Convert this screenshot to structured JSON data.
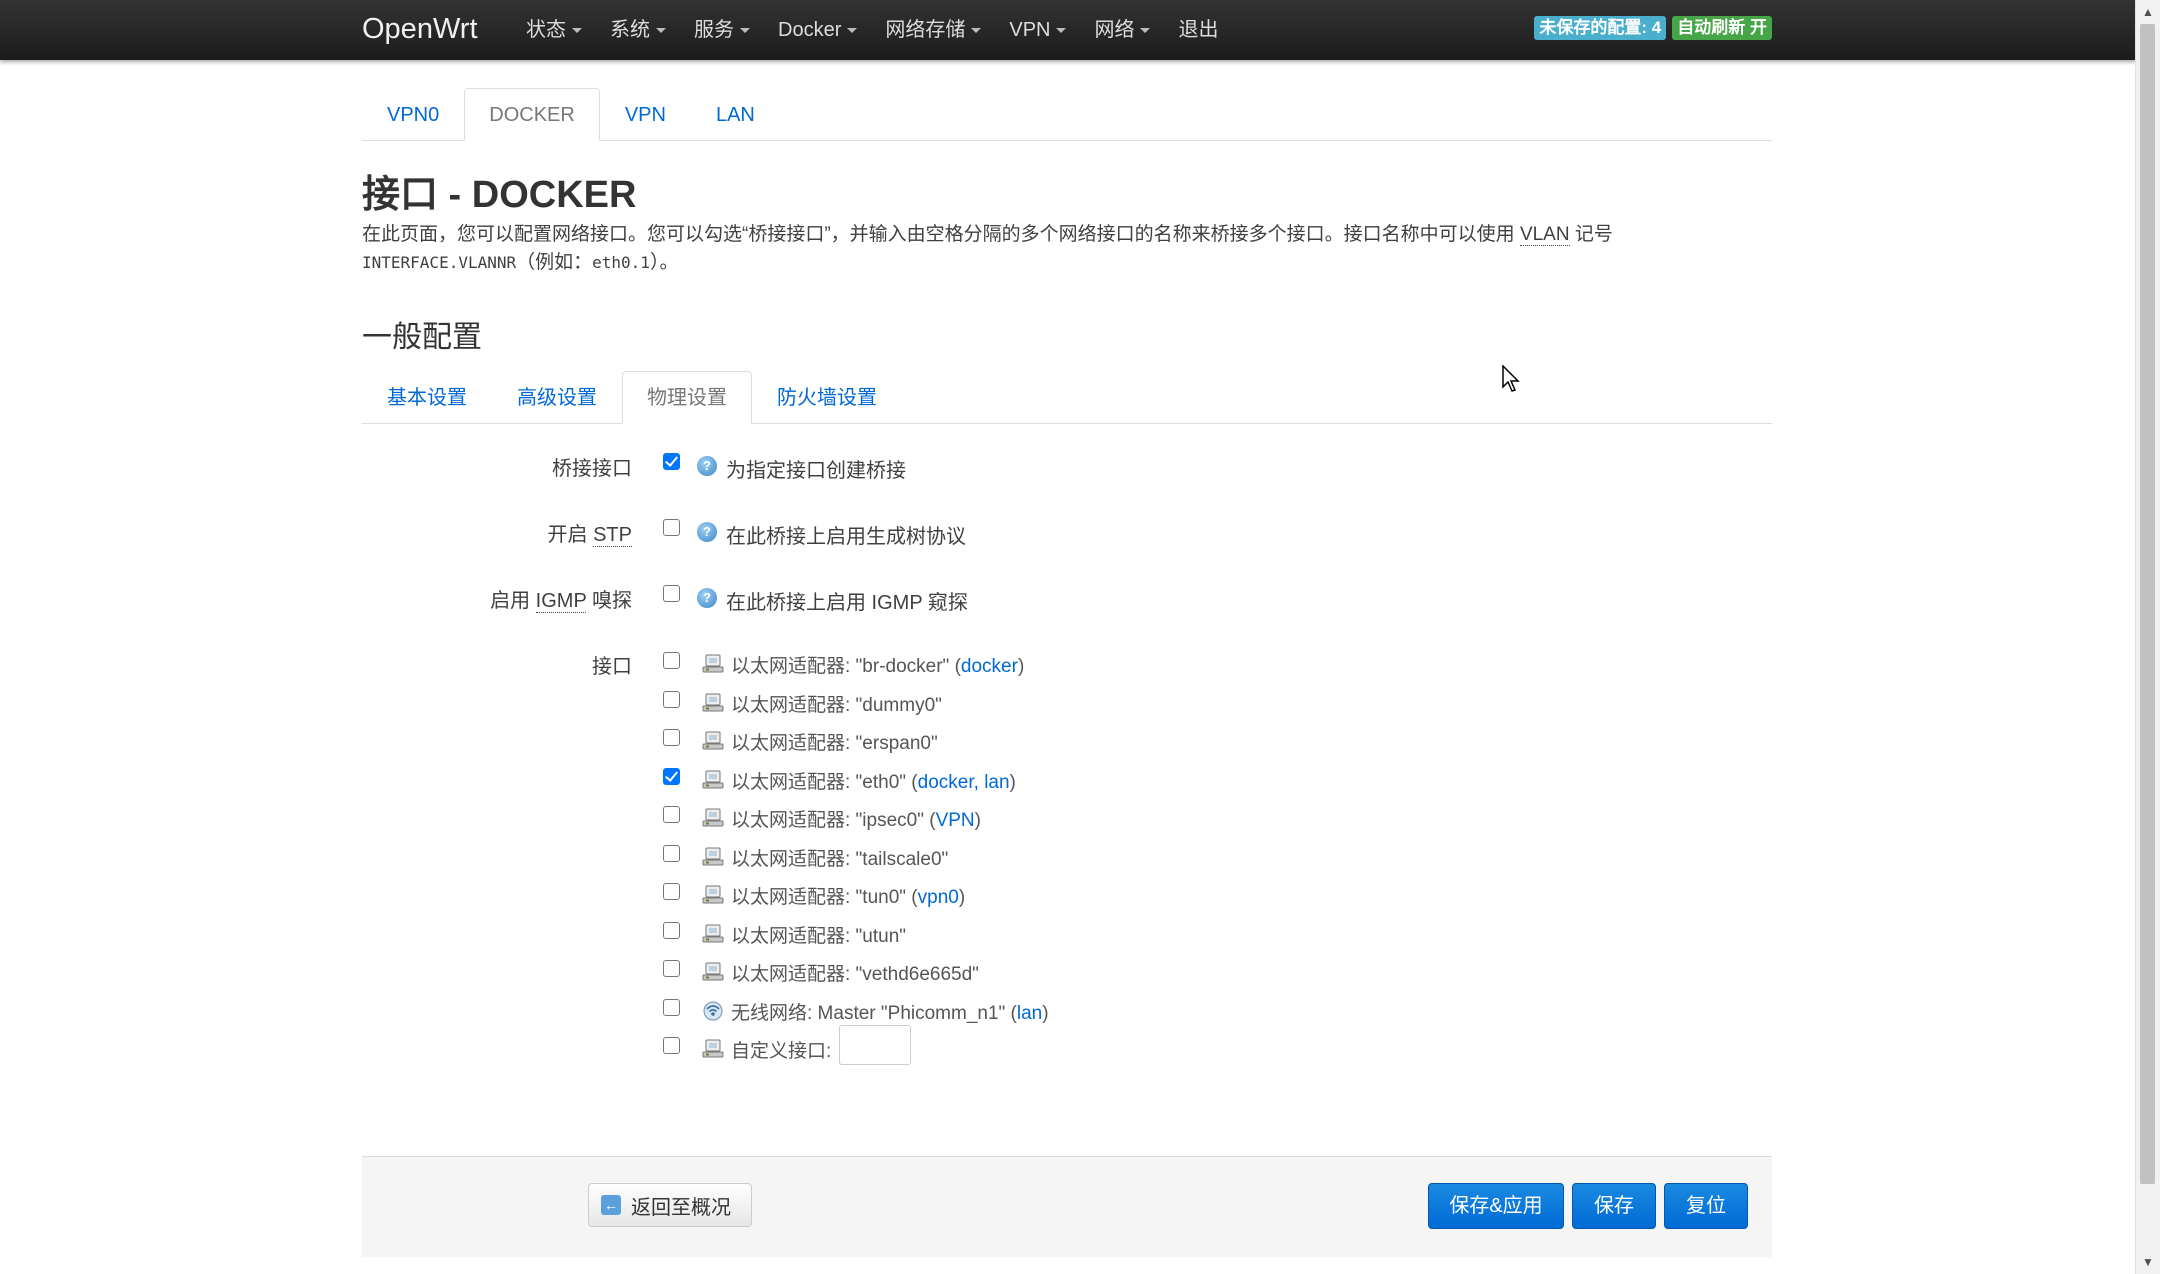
{
  "navbar": {
    "brand": "OpenWrt",
    "menu": [
      {
        "label": "状态",
        "dropdown": true
      },
      {
        "label": "系统",
        "dropdown": true
      },
      {
        "label": "服务",
        "dropdown": true
      },
      {
        "label": "Docker",
        "dropdown": true
      },
      {
        "label": "网络存储",
        "dropdown": true
      },
      {
        "label": "VPN",
        "dropdown": true
      },
      {
        "label": "网络",
        "dropdown": true
      },
      {
        "label": "退出",
        "dropdown": false
      }
    ],
    "badges": {
      "unsaved": "未保存的配置: 4",
      "autorefresh": "自动刷新 开"
    }
  },
  "iface_tabs": [
    {
      "label": "VPN0",
      "active": false
    },
    {
      "label": "DOCKER",
      "active": true
    },
    {
      "label": "VPN",
      "active": false
    },
    {
      "label": "LAN",
      "active": false
    }
  ],
  "page": {
    "title": "接口 - DOCKER",
    "desc_part1": "在此页面，您可以配置网络接口。您可以勾选“桥接接口”，并输入由空格分隔的多个网络接口的名称来桥接多个接口。接口名称中可以使用 ",
    "desc_abbr": "VLAN",
    "desc_part2": " 记号",
    "desc_mono1": "INTERFACE.VLANNR",
    "desc_part3": "（例如：",
    "desc_mono2": "eth0.1",
    "desc_part4": "）。"
  },
  "section": {
    "title": "一般配置",
    "subtabs": [
      {
        "label": "基本设置",
        "active": false
      },
      {
        "label": "高级设置",
        "active": false
      },
      {
        "label": "物理设置",
        "active": true
      },
      {
        "label": "防火墙设置",
        "active": false
      }
    ]
  },
  "options": {
    "bridge": {
      "label": "桥接接口",
      "help": "为指定接口创建桥接",
      "checked": true
    },
    "stp": {
      "label_prefix": "开启 ",
      "label_abbr": "STP",
      "help": "在此桥接上启用生成树协议",
      "checked": false
    },
    "igmp": {
      "label_prefix": "启用 ",
      "label_abbr": "IGMP",
      "label_suffix": " 嗅探",
      "help": "在此桥接上启用 IGMP 窥探",
      "checked": false
    }
  },
  "interfaces": {
    "label": "接口",
    "items": [
      {
        "text": "以太网适配器: \"br-docker\" (",
        "links": "docker",
        "tail": ")",
        "checked": false,
        "type": "ethernet"
      },
      {
        "text": "以太网适配器: \"dummy0\"",
        "links": "",
        "tail": "",
        "checked": false,
        "type": "ethernet"
      },
      {
        "text": "以太网适配器: \"erspan0\"",
        "links": "",
        "tail": "",
        "checked": false,
        "type": "ethernet"
      },
      {
        "text": "以太网适配器: \"eth0\" (",
        "links": "docker, lan",
        "tail": ")",
        "checked": true,
        "type": "ethernet"
      },
      {
        "text": "以太网适配器: \"ipsec0\" (",
        "links": "VPN",
        "tail": ")",
        "checked": false,
        "type": "ethernet"
      },
      {
        "text": "以太网适配器: \"tailscale0\"",
        "links": "",
        "tail": "",
        "checked": false,
        "type": "ethernet"
      },
      {
        "text": "以太网适配器: \"tun0\" (",
        "links": "vpn0",
        "tail": ")",
        "checked": false,
        "type": "ethernet"
      },
      {
        "text": "以太网适配器: \"utun\"",
        "links": "",
        "tail": "",
        "checked": false,
        "type": "ethernet"
      },
      {
        "text": "以太网适配器: \"vethd6e665d\"",
        "links": "",
        "tail": "",
        "checked": false,
        "type": "ethernet"
      },
      {
        "text": "无线网络: Master \"Phicomm_n1\" (",
        "links": "lan",
        "tail": ")",
        "checked": false,
        "type": "wireless"
      },
      {
        "text": "自定义接口:",
        "links": "",
        "tail": "",
        "checked": false,
        "type": "custom",
        "input_value": ""
      }
    ]
  },
  "actions": {
    "back": "返回至概况",
    "save_apply": "保存&应用",
    "save": "保存",
    "reset": "复位"
  },
  "colors": {
    "navbar_bg": "#222222",
    "link": "#0069d6",
    "badge_unsaved": "#49afcd",
    "badge_refresh": "#46a546",
    "primary_button": "#0069d6"
  }
}
